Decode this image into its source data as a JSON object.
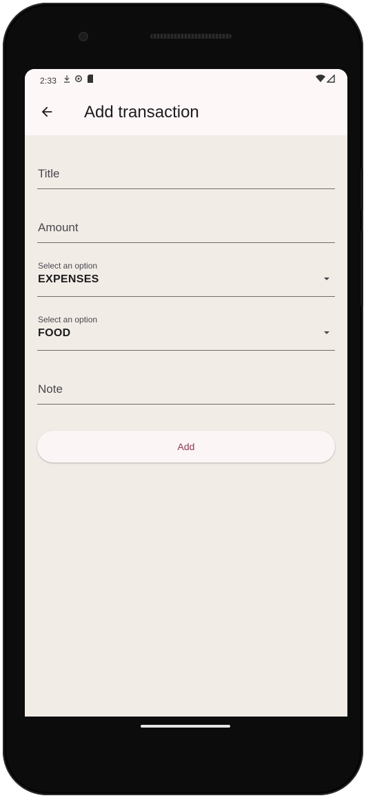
{
  "status_bar": {
    "time": "2:33",
    "icons_left": [
      "download-icon",
      "settings-icon",
      "sd-card-icon"
    ],
    "icons_right": [
      "wifi-icon",
      "signal-icon"
    ]
  },
  "app_bar": {
    "back_icon": "arrow-left-icon",
    "title": "Add transaction"
  },
  "form": {
    "title_field": {
      "placeholder": "Title",
      "value": ""
    },
    "amount_field": {
      "placeholder": "Amount",
      "value": ""
    },
    "type_dropdown": {
      "caption": "Select an option",
      "value": "EXPENSES"
    },
    "category_dropdown": {
      "caption": "Select an option",
      "value": "FOOD"
    },
    "note_field": {
      "placeholder": "Note",
      "value": ""
    },
    "add_button_label": "Add"
  },
  "colors": {
    "screen_background": "#f1ede6",
    "app_bar_background": "#fdf7f8",
    "button_text": "#8d3a4f",
    "frame": "#0c0c0d"
  }
}
